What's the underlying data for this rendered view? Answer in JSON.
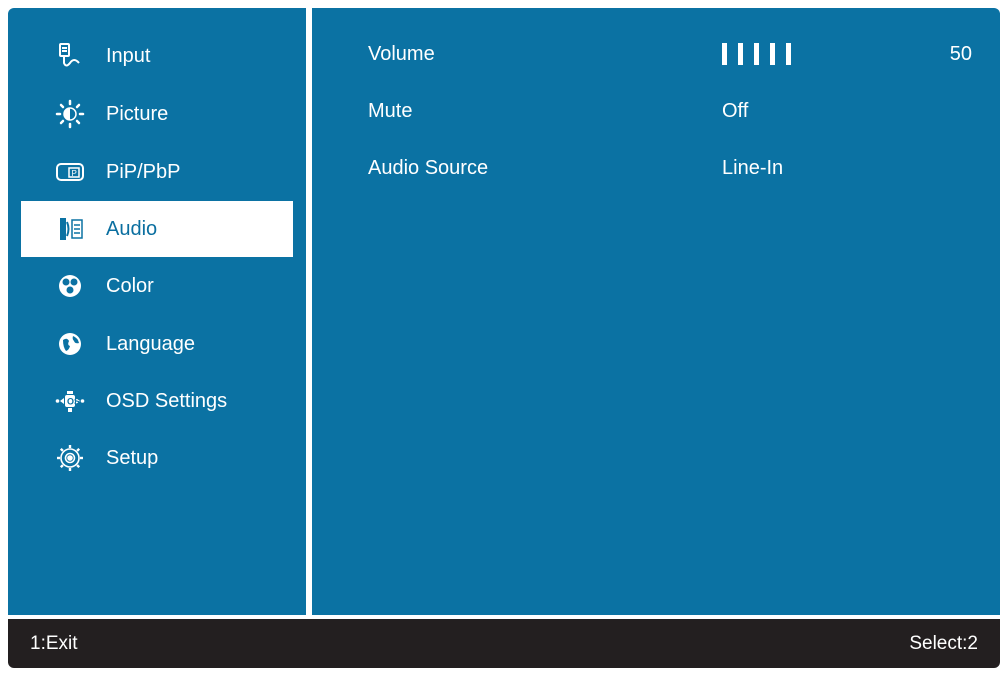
{
  "colors": {
    "panel_blue": "#0b72a3",
    "selected_bg": "#ffffff",
    "footer_bg": "#231f20",
    "text": "#ffffff"
  },
  "sidebar": {
    "items": [
      {
        "label": "Input",
        "icon": "input-icon",
        "selected": false
      },
      {
        "label": "Picture",
        "icon": "brightness-icon",
        "selected": false
      },
      {
        "label": "PiP/PbP",
        "icon": "pip-icon",
        "selected": false
      },
      {
        "label": "Audio",
        "icon": "audio-icon",
        "selected": true
      },
      {
        "label": "Color",
        "icon": "color-icon",
        "selected": false
      },
      {
        "label": "Language",
        "icon": "globe-icon",
        "selected": false
      },
      {
        "label": "OSD Settings",
        "icon": "osd-settings-icon",
        "selected": false
      },
      {
        "label": "Setup",
        "icon": "gear-icon",
        "selected": false
      }
    ]
  },
  "audio": {
    "volume": {
      "label": "Volume",
      "value": "50",
      "bar_count": 5
    },
    "mute": {
      "label": "Mute",
      "value": "Off"
    },
    "source": {
      "label": "Audio Source",
      "value": "Line-In"
    }
  },
  "footer": {
    "left": "1:Exit",
    "right": "Select:2"
  }
}
